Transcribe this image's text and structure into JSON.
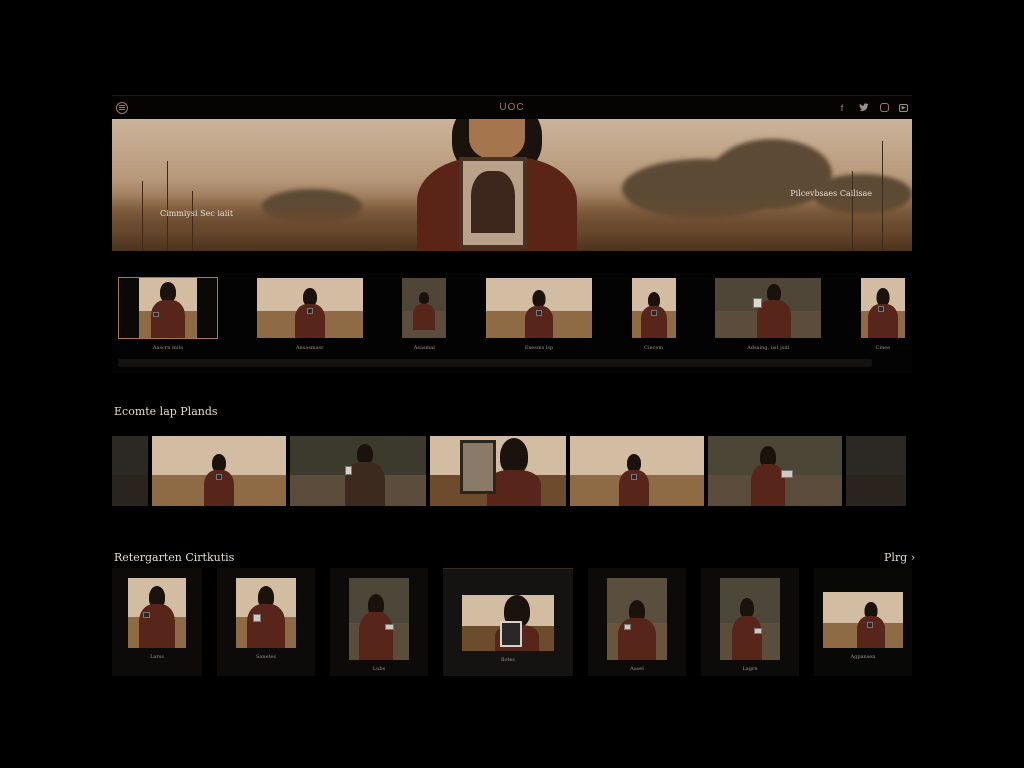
{
  "header": {
    "logo": "UOC",
    "menu_icon": "menu-icon",
    "social": [
      "f",
      "twitter-bird-icon",
      "instagram-icon",
      "youtube-icon"
    ]
  },
  "hero": {
    "caption_left": "Cimmiysi Sec iaiit",
    "caption_right": "Pilcevbsaes Cailisae"
  },
  "strip": {
    "items": [
      {
        "caption": "Aascrn lnits",
        "selected": true
      },
      {
        "caption": "Ansasmasr"
      },
      {
        "caption": "Asasmal"
      },
      {
        "caption": "Exesms lsp"
      },
      {
        "caption": "Ciecem"
      },
      {
        "caption": "Adsaing, iist jsitl"
      },
      {
        "caption": "Cinee"
      }
    ]
  },
  "section1": {
    "title": "Ecomte lap Plands"
  },
  "section2": {
    "title": "Retergarten Cirtkutis",
    "action": "Plrg"
  },
  "cards": {
    "items": [
      {
        "caption": "Larss"
      },
      {
        "caption": "Sanetes"
      },
      {
        "caption": "Lubs"
      },
      {
        "caption": "Ilotes"
      },
      {
        "caption": "Aasel"
      },
      {
        "caption": "Lagrn"
      },
      {
        "caption": "Agpansen"
      }
    ]
  },
  "colors": {
    "accent": "#a7784a",
    "background": "#000000"
  }
}
